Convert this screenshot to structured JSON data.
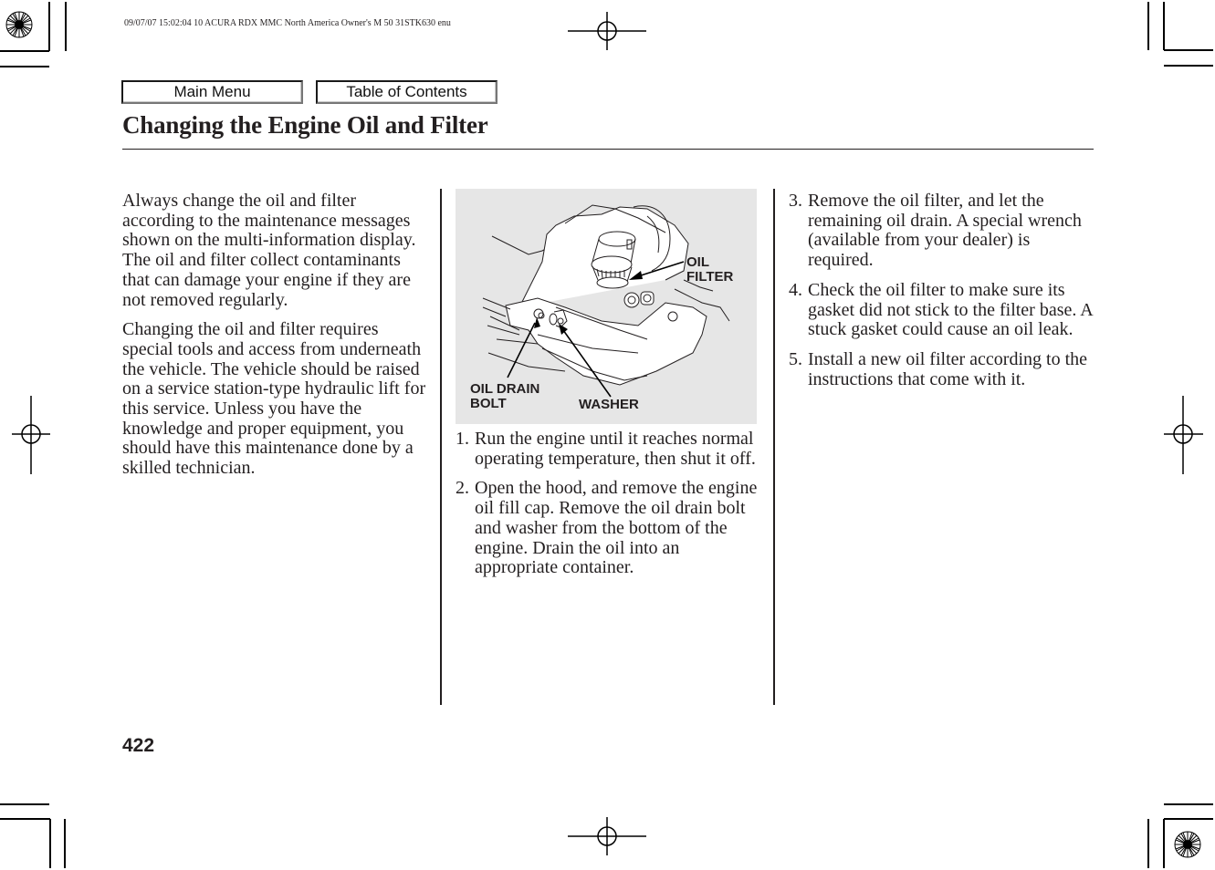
{
  "print_header": {
    "meta_text": "09/07/07 15:02:04    10 ACURA RDX MMC North America Owner's M 50 31STK630 enu"
  },
  "nav": {
    "main_menu_label": "Main Menu",
    "table_of_contents_label": "Table of Contents"
  },
  "page": {
    "title": "Changing the Engine Oil and Filter",
    "page_number": "422"
  },
  "column1": {
    "paragraphs": [
      "Always change the oil and filter according to the maintenance messages shown on the multi-information display. The oil and filter collect contaminants that can damage your engine if they are not removed regularly.",
      "Changing the oil and filter requires special tools and access from underneath the vehicle. The vehicle should be raised on a service station-type hydraulic lift for this service. Unless you have the knowledge and proper equipment, you should have this maintenance done by a skilled technician."
    ]
  },
  "figure": {
    "labels": {
      "oil_filter_line1": "OIL",
      "oil_filter_line2": "FILTER",
      "drain_bolt_line1": "OIL DRAIN",
      "drain_bolt_line2": "BOLT",
      "washer": "WASHER"
    }
  },
  "steps": [
    {
      "num": "1.",
      "text": "Run the engine until it reaches normal operating temperature, then shut it off."
    },
    {
      "num": "2.",
      "text": "Open the hood, and remove the engine oil fill cap. Remove the oil drain bolt and washer from the bottom of the engine. Drain the oil into an appropriate container."
    },
    {
      "num": "3.",
      "text": "Remove the oil filter, and let the remaining oil drain. A special wrench (available from your dealer) is required."
    },
    {
      "num": "4.",
      "text": "Check the oil filter to make sure its gasket did not stick to the filter base. A stuck gasket could cause an oil leak."
    },
    {
      "num": "5.",
      "text": "Install a new oil filter according to the instructions that come with it."
    }
  ]
}
